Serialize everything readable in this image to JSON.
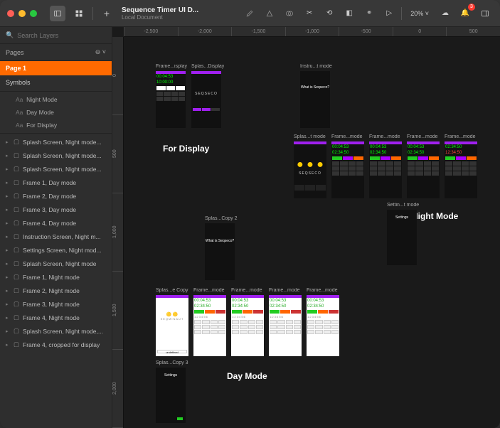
{
  "titlebar": {
    "doc_title": "Sequence Timer UI D...",
    "doc_subtitle": "Local Document",
    "zoom": "20%",
    "notification_count": "3"
  },
  "sidebar": {
    "search_placeholder": "Search Layers",
    "pages_label": "Pages",
    "pages": [
      "Page 1",
      "Symbols"
    ],
    "sections": [
      {
        "prefix": "Aa",
        "label": "Night Mode"
      },
      {
        "prefix": "Aa",
        "label": "Day Mode"
      },
      {
        "prefix": "Aa",
        "label": "For Display"
      }
    ],
    "layers": [
      "Splash Screen, Night mode...",
      "Splash Screen, Night mode...",
      "Splash Screen, Night mode...",
      "Frame 1, Day mode",
      "Frame 2, Day mode",
      "Frame 3, Day mode",
      "Frame 4, Day mode",
      "Instruction Screen, Night m...",
      "Settings Screen, Night mod...",
      "Splash Screen, Night mode",
      "Frame 1, Night mode",
      "Frame 2, Night mode",
      "Frame 3, Night mode",
      "Frame 4, Night mode",
      "Splash Screen, Night mode,...",
      "Frame 4, cropped for display"
    ]
  },
  "ruler_h": [
    "-2,500",
    "-2,000",
    "-1,500",
    "-1,000",
    "-500",
    "0",
    "500"
  ],
  "ruler_v": [
    "0",
    "500",
    "1,000",
    "1,500",
    "2,000"
  ],
  "canvas": {
    "section_labels": {
      "for_display": "For Display",
      "night_mode": "Night Mode",
      "day_mode": "Day Mode"
    },
    "for_display": {
      "ab1_label": "Frame...isplay",
      "ab1_timer1": "00:04:53",
      "ab1_timer2": "10:00:00",
      "ab2_label": "Splas...Display",
      "ab2_brand": "SEQSECO"
    },
    "instruction": {
      "label": "Instru...t mode",
      "heading": "What is Seqseco?"
    },
    "night_mode": [
      {
        "label": "Splas...t mode",
        "brand": "SEQSECO"
      },
      {
        "label": "Frame...mode",
        "t1": "00:04:53",
        "t2": "02:34:50"
      },
      {
        "label": "Frame...mode",
        "t1": "00:04:53",
        "t2": "02:34:50"
      },
      {
        "label": "Frame...mode",
        "t1": "00:04:53",
        "t2": "02:34:50"
      },
      {
        "label": "Frame...mode",
        "t1": "02:34:50",
        "t2": "12:34:50"
      }
    ],
    "settings": {
      "label": "Settin...t mode",
      "heading": "Settings"
    },
    "splash_copy2": {
      "label": "Splas...Copy 2",
      "heading": "What is Seqseco?"
    },
    "splash_copy3": {
      "label": "Splas...Copy 3",
      "heading": "Settings"
    },
    "day_mode": [
      {
        "label": "Splas...e Copy",
        "brand": "SEQMINAUT"
      },
      {
        "label": "Frame...mode",
        "t1": "00:04:53",
        "t2": "02:34:50",
        "btns": "1:2  3:4  5:6"
      },
      {
        "label": "Frame...mode",
        "t1": "00:04:53",
        "t2": "02:34:50",
        "btns": "1:2  3:4  5:6"
      },
      {
        "label": "Frame...mode",
        "t1": "00:04:53",
        "t2": "02:34:50",
        "btns": "1:2  3:4  5:6"
      },
      {
        "label": "Frame...mode",
        "t1": "00:04:53",
        "t2": "02:34:50",
        "btns": "1:2  3:4  5:6"
      }
    ]
  }
}
